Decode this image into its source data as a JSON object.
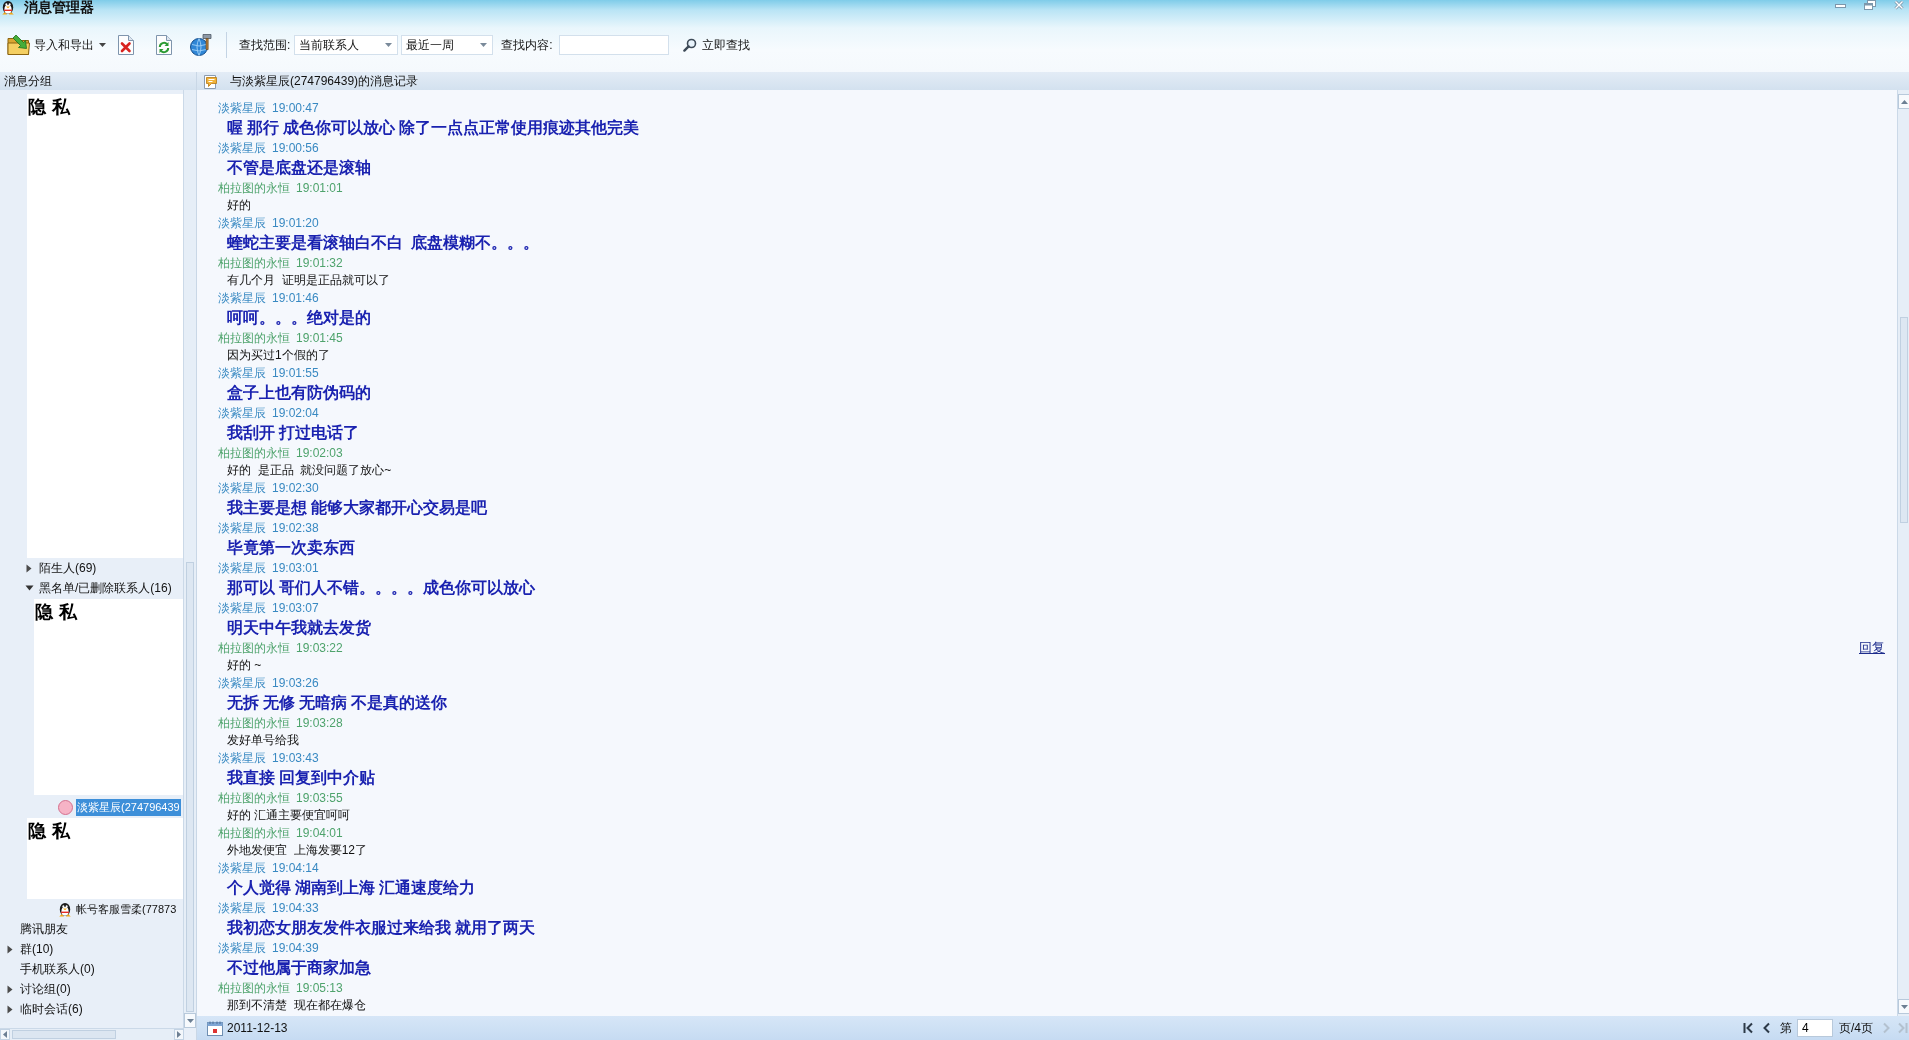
{
  "window": {
    "title": "消息管理器"
  },
  "toolbar": {
    "buttons": [
      {
        "kind": "import_export",
        "label": "导入和导出"
      },
      {
        "kind": "delete"
      },
      {
        "kind": "refresh"
      },
      {
        "kind": "tools"
      }
    ],
    "search": {
      "scope_label": "查找范围:",
      "scope": "当前联系人",
      "period": "最近一周",
      "content_label": "查找内容:",
      "button": "立即查找"
    }
  },
  "sidebar": {
    "title": "消息分组",
    "items": [
      {
        "kind": "redacted",
        "label": "隐私",
        "children": [
          {
            "kind": "group",
            "label": "陌生人(69)",
            "expanded": false,
            "selected": false
          },
          {
            "kind": "group",
            "label": "黑名单/已删除联系人(16)",
            "expanded": true,
            "selected": false,
            "children": [
              {
                "kind": "redacted",
                "label": "隐私"
              },
              {
                "kind": "contact",
                "label": "淡紫星辰(274796439",
                "selected": true
              },
              {
                "kind": "redacted",
                "label": "隐私"
              },
              {
                "kind": "service_contact",
                "label": "帐号客服雪柔(77873",
                "selected": false
              }
            ]
          }
        ]
      },
      {
        "kind": "leaf",
        "label": "腾讯朋友",
        "selected": false
      },
      {
        "kind": "group",
        "label": "群(10)",
        "expanded": false,
        "selected": false
      },
      {
        "kind": "leaf",
        "label": "手机联系人(0)",
        "selected": false
      },
      {
        "kind": "group",
        "label": "讨论组(0)",
        "expanded": false,
        "selected": false
      },
      {
        "kind": "group",
        "label": "临时会话(6)",
        "expanded": false,
        "selected": false
      }
    ]
  },
  "conversation": {
    "title": "与淡紫星辰(274796439)的消息记录",
    "messages": [
      {
        "kind": "received",
        "sender": "淡紫星辰",
        "time": "19:00:47",
        "text": "喔 那行 成色你可以放心 除了一点点正常使用痕迹其他完美"
      },
      {
        "kind": "received",
        "sender": "淡紫星辰",
        "time": "19:00:56",
        "text": "不管是底盘还是滚轴"
      },
      {
        "kind": "sent",
        "sender": "柏拉图的永恒",
        "time": "19:01:01",
        "text": "好的"
      },
      {
        "kind": "received",
        "sender": "淡紫星辰",
        "time": "19:01:20",
        "text": "蝰蛇主要是看滚轴白不白  底盘模糊不。。。"
      },
      {
        "kind": "sent",
        "sender": "柏拉图的永恒",
        "time": "19:01:32",
        "text": "有几个月  证明是正品就可以了"
      },
      {
        "kind": "received",
        "sender": "淡紫星辰",
        "time": "19:01:46",
        "text": "呵呵。。。绝对是的"
      },
      {
        "kind": "sent",
        "sender": "柏拉图的永恒",
        "time": "19:01:45",
        "text": "因为买过1个假的了"
      },
      {
        "kind": "received",
        "sender": "淡紫星辰",
        "time": "19:01:55",
        "text": "盒子上也有防伪码的"
      },
      {
        "kind": "received",
        "sender": "淡紫星辰",
        "time": "19:02:04",
        "text": "我刮开 打过电话了"
      },
      {
        "kind": "sent",
        "sender": "柏拉图的永恒",
        "time": "19:02:03",
        "text": "好的  是正品  就没问题了放心~"
      },
      {
        "kind": "received",
        "sender": "淡紫星辰",
        "time": "19:02:30",
        "text": "我主要是想 能够大家都开心交易是吧"
      },
      {
        "kind": "received",
        "sender": "淡紫星辰",
        "time": "19:02:38",
        "text": "毕竟第一次卖东西"
      },
      {
        "kind": "received",
        "sender": "淡紫星辰",
        "time": "19:03:01",
        "text": "那可以 哥们人不错。。。。成色你可以放心"
      },
      {
        "kind": "received",
        "sender": "淡紫星辰",
        "time": "19:03:07",
        "text": "明天中午我就去发货"
      },
      {
        "kind": "sent",
        "sender": "柏拉图的永恒",
        "time": "19:03:22",
        "text": "好的 ~",
        "reply_link": "回复"
      },
      {
        "kind": "received",
        "sender": "淡紫星辰",
        "time": "19:03:26",
        "text": "无拆 无修 无暗病 不是真的送你"
      },
      {
        "kind": "sent",
        "sender": "柏拉图的永恒",
        "time": "19:03:28",
        "text": "发好单号给我"
      },
      {
        "kind": "received",
        "sender": "淡紫星辰",
        "time": "19:03:43",
        "text": "我直接 回复到中介贴"
      },
      {
        "kind": "sent",
        "sender": "柏拉图的永恒",
        "time": "19:03:55",
        "text": "好的 汇通主要便宜呵呵"
      },
      {
        "kind": "sent",
        "sender": "柏拉图的永恒",
        "time": "19:04:01",
        "text": "外地发便宜  上海发要12了"
      },
      {
        "kind": "received",
        "sender": "淡紫星辰",
        "time": "19:04:14",
        "text": "个人觉得 湖南到上海 汇通速度给力"
      },
      {
        "kind": "received",
        "sender": "淡紫星辰",
        "time": "19:04:33",
        "text": "我初恋女朋友发件衣服过来给我 就用了两天"
      },
      {
        "kind": "received",
        "sender": "淡紫星辰",
        "time": "19:04:39",
        "text": "不过他属于商家加急"
      },
      {
        "kind": "sent",
        "sender": "柏拉图的永恒",
        "time": "19:05:13",
        "text": "那到不清楚  现在都在爆仓"
      }
    ]
  },
  "status_bar": {
    "date": "2011-12-13",
    "pager": {
      "prefix": "第",
      "page": "4",
      "suffix": "页/4页",
      "buttons": [
        {
          "kind": "first",
          "disabled": false
        },
        {
          "kind": "prev",
          "disabled": false
        },
        {
          "kind": "next",
          "disabled": true
        },
        {
          "kind": "last",
          "disabled": true
        }
      ]
    }
  }
}
